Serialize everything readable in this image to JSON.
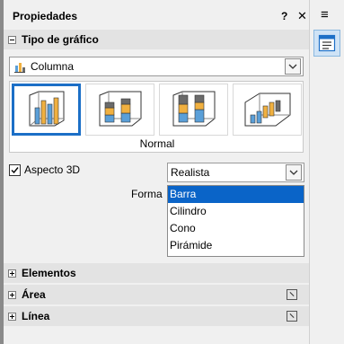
{
  "panel": {
    "title": "Propiedades",
    "help_label": "?",
    "close_label": "✕",
    "menu_label": "≡"
  },
  "chart_type_section": {
    "title": "Tipo de gráfico",
    "type_value": "Columna",
    "variant_label": "Normal",
    "aspect_3d_label": "Aspecto 3D",
    "aspect_3d_checked": true,
    "scheme_value": "Realista",
    "shape_label": "Forma",
    "shape_options": [
      "Barra",
      "Cilindro",
      "Cono",
      "Pirámide"
    ],
    "shape_selected": "Barra"
  },
  "sections": {
    "elements": "Elementos",
    "area": "Área",
    "line": "Línea"
  },
  "colors": {
    "accent": "#1c6fc7",
    "selection": "#0a64c8",
    "bar_blue": "#5a9fd8",
    "bar_orange": "#f0b040"
  }
}
